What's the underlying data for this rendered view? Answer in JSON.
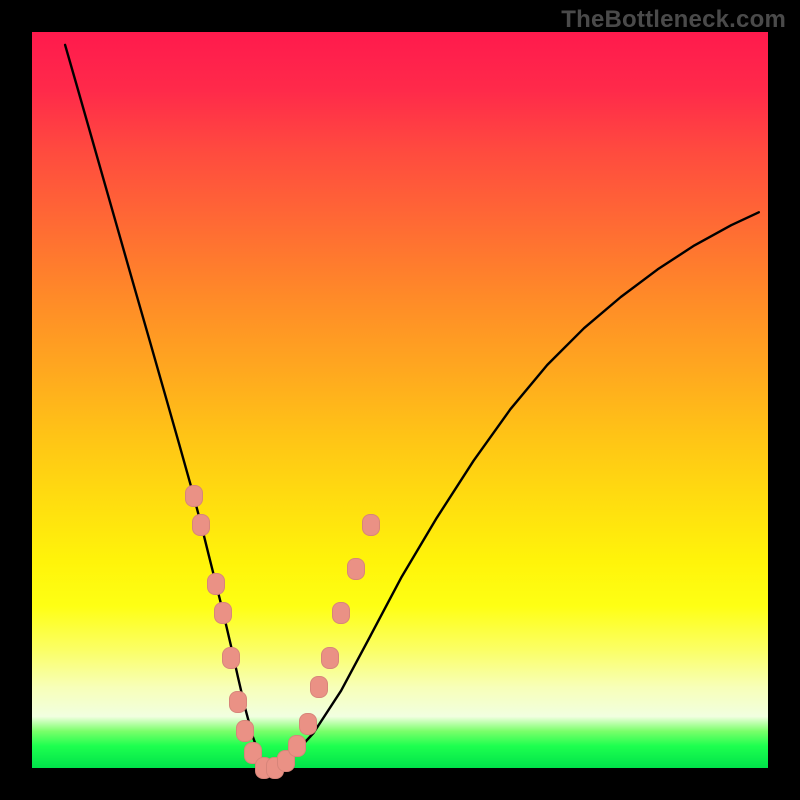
{
  "watermark": "TheBottleneck.com",
  "colors": {
    "curve": "#000000",
    "marker": "#ea9185",
    "gradient_top": "#ff1a4d",
    "gradient_bottom": "#00e24a",
    "frame": "#000000"
  },
  "chart_data": {
    "type": "line",
    "title": "",
    "xlabel": "",
    "ylabel": "",
    "xlim": [
      0,
      100
    ],
    "ylim": [
      0,
      100
    ],
    "x": [
      4,
      6,
      8,
      10,
      12,
      14,
      16,
      18,
      20,
      22,
      23,
      24,
      25,
      26,
      27,
      28,
      29,
      30,
      31,
      32,
      33,
      35,
      38,
      42,
      46,
      50,
      55,
      60,
      65,
      70,
      75,
      80,
      85,
      90,
      95,
      100
    ],
    "series": [
      {
        "name": "bottleneck-curve",
        "values": [
          100,
          93,
          86,
          79,
          72,
          65,
          58,
          51,
          44,
          37,
          33,
          29,
          25,
          21,
          17,
          12,
          8,
          4,
          1,
          0,
          0,
          1,
          4,
          10,
          18,
          26,
          34,
          42,
          49,
          55,
          60,
          64,
          68,
          71,
          74,
          76
        ]
      }
    ],
    "markers": [
      {
        "x": 22,
        "y": 37
      },
      {
        "x": 23,
        "y": 33
      },
      {
        "x": 25,
        "y": 25
      },
      {
        "x": 26,
        "y": 21
      },
      {
        "x": 27,
        "y": 15
      },
      {
        "x": 28,
        "y": 9
      },
      {
        "x": 29,
        "y": 5
      },
      {
        "x": 30,
        "y": 2
      },
      {
        "x": 31.5,
        "y": 0
      },
      {
        "x": 33,
        "y": 0
      },
      {
        "x": 34.5,
        "y": 1
      },
      {
        "x": 36,
        "y": 3
      },
      {
        "x": 37.5,
        "y": 6
      },
      {
        "x": 39,
        "y": 11
      },
      {
        "x": 40.5,
        "y": 15
      },
      {
        "x": 42,
        "y": 21
      },
      {
        "x": 44,
        "y": 27
      },
      {
        "x": 46,
        "y": 33
      }
    ]
  }
}
